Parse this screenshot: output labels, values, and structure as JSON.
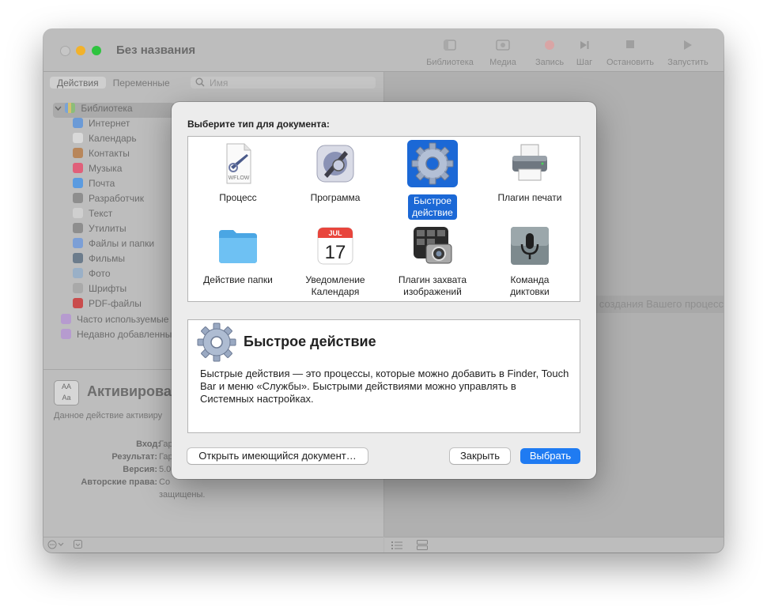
{
  "window": {
    "title": "Без названия",
    "toolbar": [
      {
        "name": "library",
        "label": "Библиотека"
      },
      {
        "name": "media",
        "label": "Медиа"
      },
      {
        "name": "record",
        "label": "Запись"
      },
      {
        "name": "step",
        "label": "Шаг"
      },
      {
        "name": "stop",
        "label": "Остановить"
      },
      {
        "name": "run",
        "label": "Запустить"
      }
    ]
  },
  "sidebar": {
    "tabs": [
      "Действия",
      "Переменные"
    ],
    "search_placeholder": "Имя",
    "library_root": "Библиотека",
    "items": [
      {
        "label": "Интернет",
        "color": "#6b9ad6"
      },
      {
        "label": "Календарь",
        "color": "#d9d9d9"
      },
      {
        "label": "Контакты",
        "color": "#b8865a"
      },
      {
        "label": "Музыка",
        "color": "#e0607a"
      },
      {
        "label": "Почта",
        "color": "#5b9be0"
      },
      {
        "label": "Разработчик",
        "color": "#8e8e8e"
      },
      {
        "label": "Текст",
        "color": "#cfcfcf"
      },
      {
        "label": "Утилиты",
        "color": "#8e8e8e"
      },
      {
        "label": "Файлы и папки",
        "color": "#7c9fd6"
      },
      {
        "label": "Фильмы",
        "color": "#6c7c8c"
      },
      {
        "label": "Фото",
        "color": "#9ab0c7"
      },
      {
        "label": "Шрифты",
        "color": "#a9a9a9"
      },
      {
        "label": "PDF-файлы",
        "color": "#c94c4c"
      }
    ],
    "smart_items": [
      "Часто используемые",
      "Недавно добавленные"
    ],
    "description": {
      "icon_text": "AA\nAa",
      "title": "Активирова",
      "text": "Данное действие активиру",
      "fields": [
        {
          "key": "Вход:",
          "value": "Гар"
        },
        {
          "key": "Результат:",
          "value": "Гар"
        },
        {
          "key": "Версия:",
          "value": "5.0"
        },
        {
          "key": "Авторские права:",
          "value": "Со"
        }
      ],
      "copyright_tail": "защищены."
    }
  },
  "workflow": {
    "hint": "создания Вашего процесс"
  },
  "dialog": {
    "prompt": "Выберите тип для документа:",
    "types": [
      {
        "id": "process",
        "label": "Процесс",
        "icon": "workflow-document-icon"
      },
      {
        "id": "app",
        "label": "Программа",
        "icon": "automator-app-icon"
      },
      {
        "id": "quick",
        "label": "Быстрое\nдействие",
        "icon": "gear-icon",
        "selected": true
      },
      {
        "id": "print",
        "label": "Плагин печати",
        "icon": "printer-icon"
      },
      {
        "id": "folder",
        "label": "Действие папки",
        "icon": "folder-icon"
      },
      {
        "id": "calendar",
        "label": "Уведомление\nКалендаря",
        "icon": "calendar-icon",
        "month": "JUL",
        "day": "17"
      },
      {
        "id": "capture",
        "label": "Плагин захвата\nизображений",
        "icon": "image-capture-icon"
      },
      {
        "id": "dictation",
        "label": "Команда\nдиктовки",
        "icon": "microphone-icon"
      }
    ],
    "info": {
      "title": "Быстрое действие",
      "text": "Быстрые действия — это процессы, которые можно добавить в Finder, Touch Bar и меню «Службы». Быстрыми действиями можно управлять в Системных настройках."
    },
    "buttons": {
      "open": "Открыть имеющийся документ…",
      "close": "Закрыть",
      "choose": "Выбрать"
    },
    "accent": "#1f7bf2"
  }
}
